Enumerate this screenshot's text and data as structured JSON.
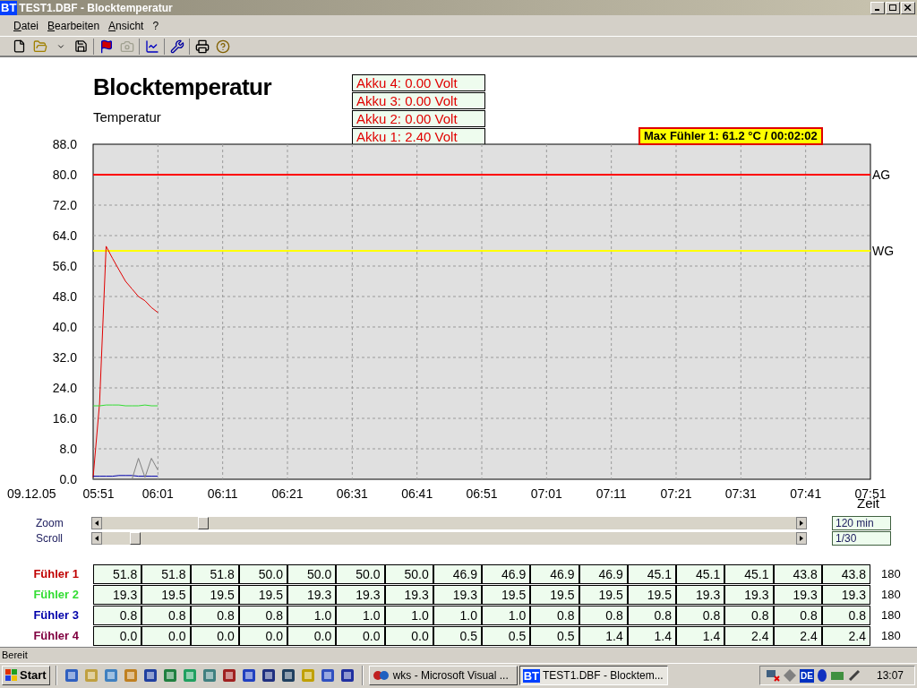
{
  "window": {
    "badge": "BT",
    "title": "TEST1.DBF - Blocktemperatur"
  },
  "menu": [
    "Datei",
    "Bearbeiten",
    "Ansicht",
    "?"
  ],
  "chart_header": {
    "akku": [
      "Akku 4: 0.00 Volt",
      "Akku 3: 0.00 Volt",
      "Akku 2: 0.00 Volt",
      "Akku 1: 2.40 Volt"
    ],
    "max_label": "Max Fühler 1: 61.2 °C / 00:02:02"
  },
  "date_label": "09.12.05",
  "chart_data": {
    "type": "line",
    "title": "Blocktemperatur",
    "ylabel": "Temperatur",
    "xlabel": "Zeit",
    "ylim": [
      0,
      88
    ],
    "categories": [
      "05:51",
      null,
      null,
      null,
      null,
      null,
      null,
      null,
      null,
      null,
      "06:01",
      null,
      null,
      null,
      null,
      null,
      null,
      null,
      null,
      null,
      "06:11",
      null,
      null,
      null,
      null,
      null,
      null,
      null,
      null,
      null,
      "06:21",
      null,
      null,
      null,
      null,
      null,
      null,
      null,
      null,
      null,
      "06:31",
      null,
      null,
      null,
      null,
      null,
      null,
      null,
      null,
      null,
      "06:41",
      null,
      null,
      null,
      null,
      null,
      null,
      null,
      null,
      null,
      "06:51",
      null,
      null,
      null,
      null,
      null,
      null,
      null,
      null,
      null,
      "07:01",
      null,
      null,
      null,
      null,
      null,
      null,
      null,
      null,
      null,
      "07:11",
      null,
      null,
      null,
      null,
      null,
      null,
      null,
      null,
      null,
      "07:21",
      null,
      null,
      null,
      null,
      null,
      null,
      null,
      null,
      null,
      "07:31",
      null,
      null,
      null,
      null,
      null,
      null,
      null,
      null,
      null,
      "07:41",
      null,
      null,
      null,
      null,
      null,
      null,
      null,
      null,
      null,
      "07:51"
    ],
    "yticks": [
      {
        "value": 0,
        "label": "0.0"
      },
      {
        "value": 8,
        "label": "8.0"
      },
      {
        "value": 16,
        "label": "16.0"
      },
      {
        "value": 24,
        "label": "24.0"
      },
      {
        "value": 32,
        "label": "32.0"
      },
      {
        "value": 40,
        "label": "40.0"
      },
      {
        "value": 48,
        "label": "48.0"
      },
      {
        "value": 56,
        "label": "56.0"
      },
      {
        "value": 64,
        "label": "64.0"
      },
      {
        "value": 72,
        "label": "72.0"
      },
      {
        "value": 80,
        "label": "80.0"
      },
      {
        "value": 88,
        "label": "88.0"
      }
    ],
    "series": [
      {
        "color": "#e00000",
        "values": [
          0.5,
          20,
          61.2,
          58,
          55,
          52,
          50,
          48,
          46.9,
          45.1,
          43.8,
          null,
          null,
          null,
          null,
          null,
          null,
          null,
          null,
          null,
          null,
          null,
          null,
          null,
          null,
          null,
          null,
          null,
          null,
          null,
          null,
          null,
          null,
          null,
          null,
          null,
          null,
          null,
          null,
          null,
          null,
          null,
          null,
          null,
          null,
          null,
          null,
          null,
          null,
          null,
          null,
          null,
          null,
          null,
          null,
          null,
          null,
          null,
          null,
          null,
          null,
          null,
          null,
          null,
          null,
          null,
          null,
          null,
          null,
          null,
          null,
          null,
          null,
          null,
          null,
          null,
          null,
          null,
          null,
          null,
          null,
          null,
          null,
          null,
          null,
          null,
          null,
          null,
          null,
          null,
          null,
          null,
          null,
          null,
          null,
          null,
          null,
          null,
          null,
          null,
          null,
          null,
          null,
          null,
          null,
          null,
          null,
          null,
          null,
          null,
          null,
          null,
          null,
          null,
          null,
          null,
          null,
          null,
          null,
          null,
          null
        ]
      },
      {
        "color": "#33dd33",
        "values": [
          19.3,
          19.3,
          19.5,
          19.5,
          19.5,
          19.3,
          19.3,
          19.3,
          19.5,
          19.3,
          19.3,
          null,
          null,
          null,
          null,
          null,
          null,
          null,
          null,
          null,
          null,
          null,
          null,
          null,
          null,
          null,
          null,
          null,
          null,
          null,
          null,
          null,
          null,
          null,
          null,
          null,
          null,
          null,
          null,
          null,
          null,
          null,
          null,
          null,
          null,
          null,
          null,
          null,
          null,
          null,
          null,
          null,
          null,
          null,
          null,
          null,
          null,
          null,
          null,
          null,
          null,
          null,
          null,
          null,
          null,
          null,
          null,
          null,
          null,
          null,
          null,
          null,
          null,
          null,
          null,
          null,
          null,
          null,
          null,
          null,
          null,
          null,
          null,
          null,
          null,
          null,
          null,
          null,
          null,
          null,
          null,
          null,
          null,
          null,
          null,
          null,
          null,
          null,
          null,
          null,
          null,
          null,
          null,
          null,
          null,
          null,
          null,
          null,
          null,
          null,
          null,
          null,
          null,
          null,
          null,
          null,
          null,
          null,
          null,
          null,
          null
        ]
      },
      {
        "color": "#0000aa",
        "values": [
          0.8,
          0.8,
          0.8,
          0.8,
          1.0,
          1.0,
          1.0,
          0.8,
          0.8,
          0.8,
          0.8,
          null,
          null,
          null,
          null,
          null,
          null,
          null,
          null,
          null,
          null,
          null,
          null,
          null,
          null,
          null,
          null,
          null,
          null,
          null,
          null,
          null,
          null,
          null,
          null,
          null,
          null,
          null,
          null,
          null,
          null,
          null,
          null,
          null,
          null,
          null,
          null,
          null,
          null,
          null,
          null,
          null,
          null,
          null,
          null,
          null,
          null,
          null,
          null,
          null,
          null,
          null,
          null,
          null,
          null,
          null,
          null,
          null,
          null,
          null,
          null,
          null,
          null,
          null,
          null,
          null,
          null,
          null,
          null,
          null,
          null,
          null,
          null,
          null,
          null,
          null,
          null,
          null,
          null,
          null,
          null,
          null,
          null,
          null,
          null,
          null,
          null,
          null,
          null,
          null,
          null,
          null,
          null,
          null,
          null,
          null,
          null,
          null,
          null,
          null,
          null,
          null,
          null,
          null,
          null,
          null,
          null,
          null,
          null,
          null,
          null
        ]
      },
      {
        "color": "#808080",
        "values": [
          0,
          0,
          0,
          0,
          0,
          0,
          0,
          5.5,
          0.5,
          5.5,
          2.4,
          null,
          null,
          null,
          null,
          null,
          null,
          null,
          null,
          null,
          null,
          null,
          null,
          null,
          null,
          null,
          null,
          null,
          null,
          null,
          null,
          null,
          null,
          null,
          null,
          null,
          null,
          null,
          null,
          null,
          null,
          null,
          null,
          null,
          null,
          null,
          null,
          null,
          null,
          null,
          null,
          null,
          null,
          null,
          null,
          null,
          null,
          null,
          null,
          null,
          null,
          null,
          null,
          null,
          null,
          null,
          null,
          null,
          null,
          null,
          null,
          null,
          null,
          null,
          null,
          null,
          null,
          null,
          null,
          null,
          null,
          null,
          null,
          null,
          null,
          null,
          null,
          null,
          null,
          null,
          null,
          null,
          null,
          null,
          null,
          null,
          null,
          null,
          null,
          null,
          null,
          null,
          null,
          null,
          null,
          null,
          null,
          null,
          null,
          null,
          null,
          null,
          null,
          null,
          null,
          null,
          null,
          null,
          null,
          null,
          null
        ]
      }
    ],
    "grid": true,
    "ref_lines": [
      {
        "axis": "y",
        "value": 80,
        "label": "AG",
        "color": "#ff0000"
      },
      {
        "axis": "y",
        "value": 60,
        "label": "WG",
        "color": "#ffff00"
      }
    ]
  },
  "sliders": [
    {
      "label": "Zoom",
      "level": 0.14,
      "reading": "120 min"
    },
    {
      "label": "Scroll",
      "level": 0.04,
      "reading": "1/30"
    }
  ],
  "table": {
    "rows": [
      {
        "label": "Fühler 1",
        "color": "#c00000",
        "cells": [
          "51.8",
          "51.8",
          "51.8",
          "50.0",
          "50.0",
          "50.0",
          "50.0",
          "46.9",
          "46.9",
          "46.9",
          "46.9",
          "45.1",
          "45.1",
          "45.1",
          "43.8",
          "43.8"
        ],
        "end": "180"
      },
      {
        "label": "Fühler 2",
        "color": "#33dd33",
        "cells": [
          "19.3",
          "19.5",
          "19.5",
          "19.5",
          "19.3",
          "19.3",
          "19.3",
          "19.3",
          "19.5",
          "19.5",
          "19.5",
          "19.5",
          "19.3",
          "19.3",
          "19.3",
          "19.3"
        ],
        "end": "180"
      },
      {
        "label": "Fühler 3",
        "color": "#0000aa",
        "cells": [
          "0.8",
          "0.8",
          "0.8",
          "0.8",
          "1.0",
          "1.0",
          "1.0",
          "1.0",
          "1.0",
          "0.8",
          "0.8",
          "0.8",
          "0.8",
          "0.8",
          "0.8",
          "0.8"
        ],
        "end": "180"
      },
      {
        "label": "Fühler 4",
        "color": "#800040",
        "cells": [
          "0.0",
          "0.0",
          "0.0",
          "0.0",
          "0.0",
          "0.0",
          "0.0",
          "0.5",
          "0.5",
          "0.5",
          "1.4",
          "1.4",
          "1.4",
          "2.4",
          "2.4",
          "2.4"
        ],
        "end": "180"
      }
    ]
  },
  "status_bar": "Bereit",
  "taskbar": {
    "start": "Start",
    "tasks": [
      {
        "label": "wks - Microsoft Visual ...",
        "selected": false
      },
      {
        "label": "TEST1.DBF - Blocktem...",
        "badge": "BT",
        "selected": true
      }
    ],
    "tray_language": "DE",
    "clock": "13:07"
  }
}
